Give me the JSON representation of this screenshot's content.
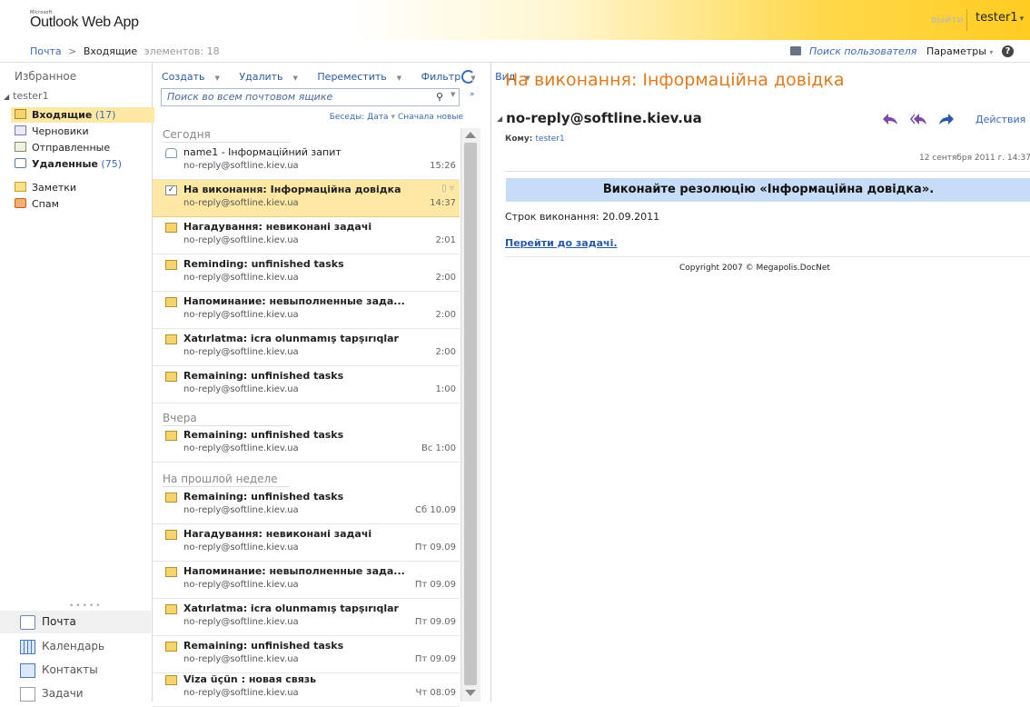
{
  "header": {
    "brand_small": "Microsoft",
    "app_name": "Outlook Web App",
    "signout": "выйти",
    "username": "tester1"
  },
  "breadcrumb": {
    "root": "Почта",
    "separator": ">",
    "folder": "Входящие",
    "count": "элементов: 18",
    "find_user": "Поиск пользователя",
    "options": "Параметры",
    "help": "?"
  },
  "nav": {
    "favorites": "Избранное",
    "account": "tester1",
    "folders": [
      {
        "label": "Входящие",
        "count": "(17)"
      },
      {
        "label": "Черновики",
        "count": ""
      },
      {
        "label": "Отправленные",
        "count": ""
      },
      {
        "label": "Удаленные",
        "count": "(75)"
      },
      {
        "label": "Заметки",
        "count": ""
      },
      {
        "label": "Спам",
        "count": ""
      }
    ],
    "modules": [
      {
        "label": "Почта"
      },
      {
        "label": "Календарь"
      },
      {
        "label": "Контакты"
      },
      {
        "label": "Задачи"
      }
    ]
  },
  "toolbar": {
    "create": "Создать",
    "delete": "Удалить",
    "move": "Переместить",
    "filter": "Фильтр",
    "view": "Вид",
    "search_placeholder": "Поиск во всем почтовом ящике",
    "conversations": "Беседы: Дата",
    "sort": "Сначала новые"
  },
  "groups": [
    "Сегодня",
    "Вчера",
    "На прошлой неделе"
  ],
  "messages": [
    {
      "subject": "name1 - Інформаційний запит",
      "from": "no-reply@softline.kiev.ua",
      "time": "15:26"
    },
    {
      "subject": "На виконання: Інформаційна довідка",
      "from": "no-reply@softline.kiev.ua",
      "time": "14:37"
    },
    {
      "subject": "Нагадування: невиконані задачі",
      "from": "no-reply@softline.kiev.ua",
      "time": "2:01"
    },
    {
      "subject": "Reminding: unfinished tasks",
      "from": "no-reply@softline.kiev.ua",
      "time": "2:00"
    },
    {
      "subject": "Напоминание: невыполненные зада...",
      "from": "no-reply@softline.kiev.ua",
      "time": "2:00"
    },
    {
      "subject": "Xatırlatma: icra olunmamış tapşırıqlar",
      "from": "no-reply@softline.kiev.ua",
      "time": "2:00"
    },
    {
      "subject": "Remaining: unfinished tasks",
      "from": "no-reply@softline.kiev.ua",
      "time": "1:00"
    },
    {
      "subject": "Remaining: unfinished tasks",
      "from": "no-reply@softline.kiev.ua",
      "time": "Вс 1:00"
    },
    {
      "subject": "Remaining: unfinished tasks",
      "from": "no-reply@softline.kiev.ua",
      "time": "Сб 10.09"
    },
    {
      "subject": "Нагадування: невиконані задачі",
      "from": "no-reply@softline.kiev.ua",
      "time": "Пт 09.09"
    },
    {
      "subject": "Напоминание: невыполненные зада...",
      "from": "no-reply@softline.kiev.ua",
      "time": "Пт 09.09"
    },
    {
      "subject": "Xatırlatma: icra olunmamış tapşırıqlar",
      "from": "no-reply@softline.kiev.ua",
      "time": "Пт 09.09"
    },
    {
      "subject": "Remaining: unfinished tasks",
      "from": "no-reply@softline.kiev.ua",
      "time": "Пт 09.09"
    },
    {
      "subject": "Viza üçün : новая связь",
      "from": "no-reply@softline.kiev.ua",
      "time": "Чт 08.09"
    }
  ],
  "reading": {
    "title": "На виконання: Інформаційна довідка",
    "from": "no-reply@softline.kiev.ua",
    "actions": "Действия",
    "to_label": "Кому:",
    "to_value": "tester1",
    "date": "12 сентября 2011 г. 14:37",
    "resolution": "Виконайте резолюцію «Інформаційна довідка».",
    "deadline": "Строк виконання: 20.09.2011",
    "link": "Перейти до задачі.",
    "copyright": "Copyright 2007 © Megapolis.DocNet"
  },
  "colors": {
    "accent": "#3a6ab4",
    "title_orange": "#e07a1e",
    "selection": "#fee8a4",
    "resolution_bar": "#c6dcf7"
  }
}
